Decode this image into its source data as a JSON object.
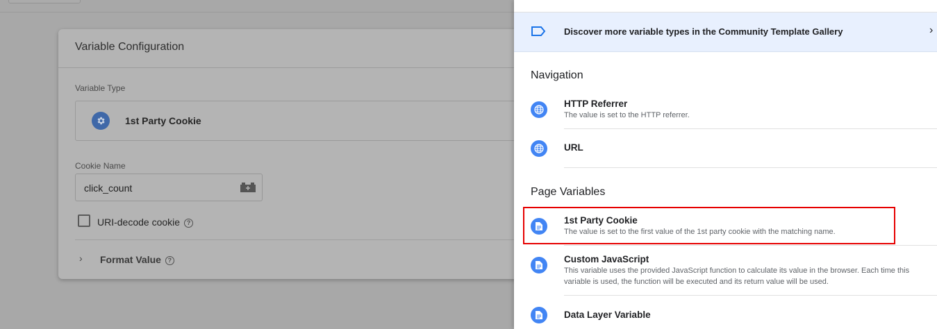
{
  "card": {
    "title": "Variable Configuration",
    "variable_type_label": "Variable Type",
    "variable_type_value": "1st Party Cookie",
    "cookie_name_label": "Cookie Name",
    "cookie_name_value": "click_count",
    "uri_decode_label": "URI-decode cookie",
    "format_value_label": "Format Value"
  },
  "panel": {
    "gallery_text": "Discover more variable types in the Community Template Gallery",
    "sections": {
      "navigation": "Navigation",
      "page_variables": "Page Variables"
    },
    "items": [
      {
        "name": "HTTP Referrer",
        "desc": "The value is set to the HTTP referrer.",
        "icon": "globe-icon"
      },
      {
        "name": "URL",
        "desc": "",
        "icon": "globe-icon"
      },
      {
        "name": "1st Party Cookie",
        "desc": "The value is set to the first value of the 1st party cookie with the matching name.",
        "icon": "document-icon"
      },
      {
        "name": "Custom JavaScript",
        "desc": "This variable uses the provided JavaScript function to calculate its value in the browser. Each time this variable is used, the function will be executed and its return value will be used.",
        "icon": "document-icon"
      },
      {
        "name": "Data Layer Variable",
        "desc": "",
        "icon": "document-icon"
      }
    ]
  },
  "colors": {
    "accent": "#4285f4",
    "highlight": "#e60000",
    "gallery_bg": "#e8f0fe"
  }
}
